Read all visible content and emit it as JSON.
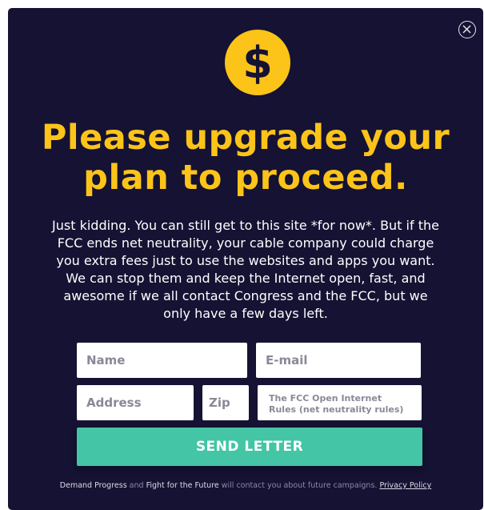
{
  "modal": {
    "close_icon": "close-icon",
    "coin_icon": "dollar-coin-icon",
    "coin_symbol": "$",
    "headline": "Please upgrade your plan to proceed.",
    "body": "Just kidding. You can still get to this site *for now*. But if the FCC ends net neutrality, your cable company could charge you extra fees just to use the websites and apps you want. We can stop them and keep the Internet open, fast, and awesome if we all contact Congress and the FCC, but we only have a few days left."
  },
  "form": {
    "name_placeholder": "Name",
    "email_placeholder": "E-mail",
    "address_placeholder": "Address",
    "zip_placeholder": "Zip",
    "comment_placeholder": "The FCC Open Internet Rules (net neutrality rules)",
    "submit_label": "SEND LETTER"
  },
  "footer": {
    "org1": "Demand Progress",
    "and": " and ",
    "org2": "Fight for the Future",
    "message": "  will contact you about future  campaigns. ",
    "privacy_link": "Privacy Policy"
  },
  "colors": {
    "background": "#151233",
    "accent_yellow": "#fcc419",
    "button_green": "#43c5a6"
  }
}
